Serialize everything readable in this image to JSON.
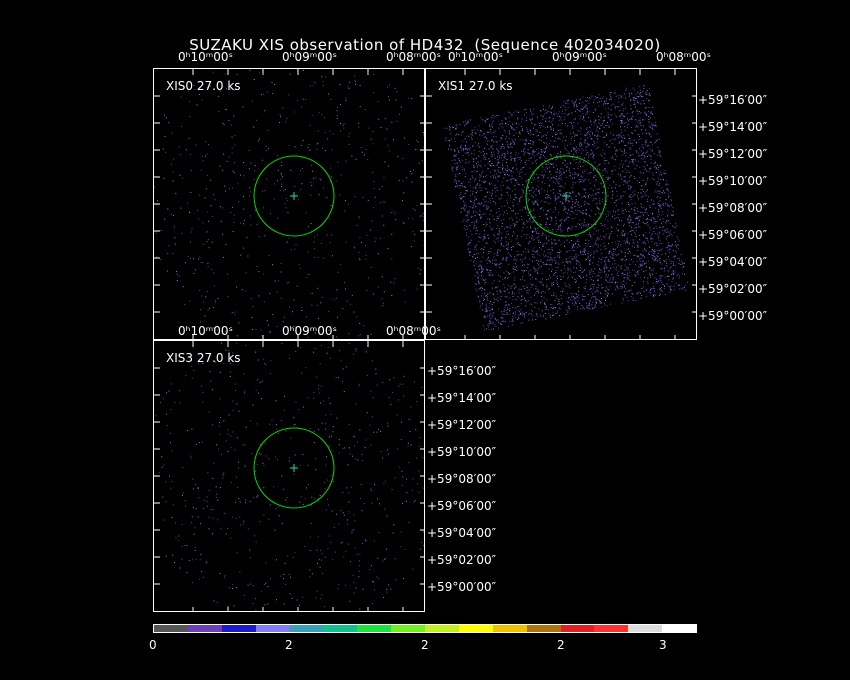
{
  "title": "SUZAKU XIS observation of HD432  (Sequence 402034020)",
  "panels": [
    {
      "id": "xis0",
      "label": "XIS0 27.0 ks"
    },
    {
      "id": "xis1",
      "label": "XIS1 27.0 ks"
    },
    {
      "id": "xis3",
      "label": "XIS3 27.0 ks"
    }
  ],
  "ra_ticks": {
    "t0": "0ʰ10ᵐ00ˢ",
    "t1": "0ʰ09ᵐ00ˢ",
    "t2": "0ʰ08ᵐ00ˢ"
  },
  "dec_ticks": [
    "+59°16′00″",
    "+59°14′00″",
    "+59°12′00″",
    "+59°10′00″",
    "+59°08′00″",
    "+59°06′00″",
    "+59°04′00″",
    "+59°02′00″",
    "+59°00′00″"
  ],
  "colorbar": {
    "colors": [
      "#555555",
      "#6a3fb8",
      "#1c1ccc",
      "#7e7eee",
      "#3aa0b8",
      "#14c08a",
      "#20e040",
      "#70f020",
      "#c0f020",
      "#ffff00",
      "#f0c000",
      "#b07010",
      "#e02020",
      "#ff3030",
      "#dddddd",
      "#ffffff"
    ],
    "labels": [
      "0",
      "2",
      "2",
      "2",
      "3"
    ]
  },
  "region_color": "#00dd00"
}
